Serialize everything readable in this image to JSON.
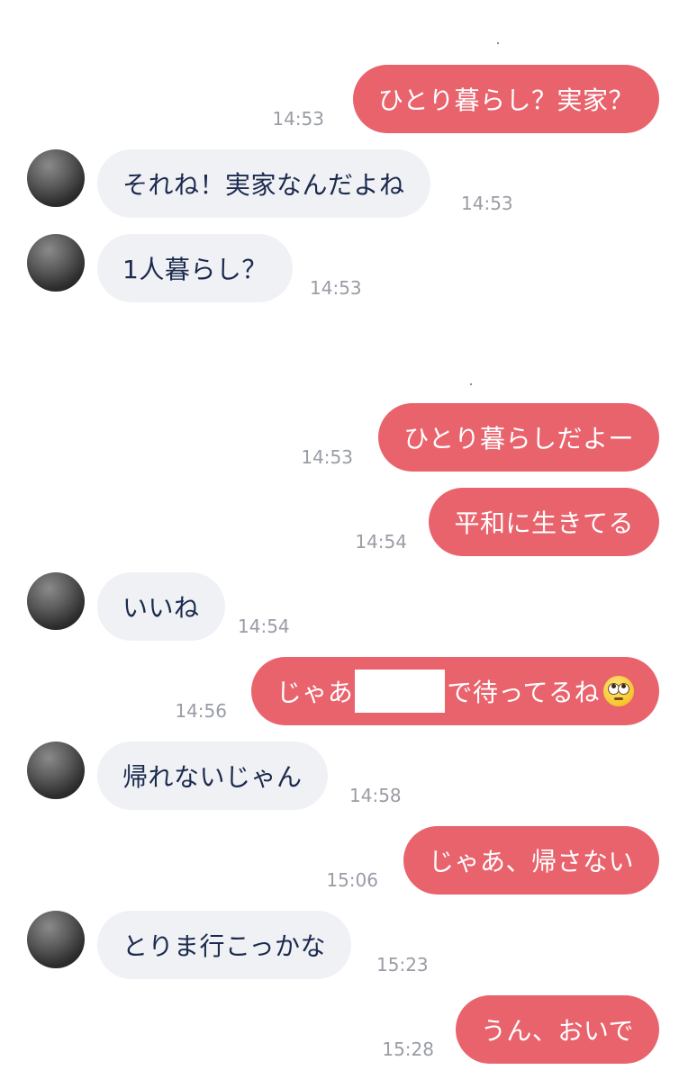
{
  "messages": [
    {
      "side": "out",
      "text": "ひとり暮らし？実家？",
      "time": "14:53"
    },
    {
      "side": "in",
      "text": "それね！実家なんだよね",
      "time": "14:53"
    },
    {
      "side": "in",
      "text": "1人暮らし？",
      "time": "14:53"
    },
    {
      "side": "out",
      "text": "ひとり暮らしだよー",
      "time": "14:53"
    },
    {
      "side": "out",
      "text": "平和に生きてる",
      "time": "14:54"
    },
    {
      "side": "in",
      "text": "いいね",
      "time": "14:54"
    },
    {
      "side": "out",
      "text_before": "じゃあ",
      "text_after": "で待ってるね",
      "emoji": "eye-roll-emoji",
      "time": "14:56"
    },
    {
      "side": "in",
      "text": "帰れないじゃん",
      "time": "14:58"
    },
    {
      "side": "out",
      "text": "じゃあ、帰さない",
      "time": "15:06"
    },
    {
      "side": "in",
      "text": "とりま行こっかな",
      "time": "15:23"
    },
    {
      "side": "out",
      "text": "うん、おいで",
      "time": "15:28"
    }
  ],
  "colors": {
    "outgoing_bubble": "#e9636d",
    "incoming_bubble": "#f0f1f4",
    "incoming_text": "#1b2a4e",
    "timestamp": "#9a9ca6"
  }
}
